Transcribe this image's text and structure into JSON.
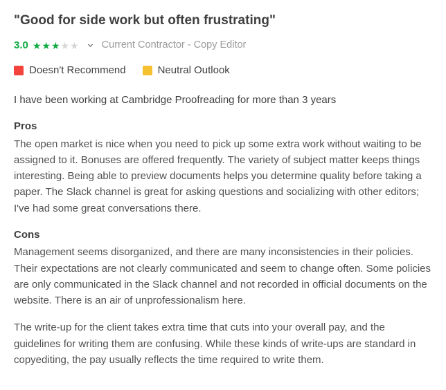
{
  "review": {
    "title": "\"Good for side work but often frustrating\"",
    "rating": "3.0",
    "stars_full": 3,
    "stars_total": 5,
    "author": "Current Contractor - Copy Editor",
    "indicators": [
      {
        "color": "red",
        "label": "Doesn't Recommend"
      },
      {
        "color": "yellow",
        "label": "Neutral Outlook"
      }
    ],
    "tenure": "I have been working at Cambridge Proofreading for more than 3 years",
    "pros_heading": "Pros",
    "pros_body": "The open market is nice when you need to pick up some extra work without waiting to be assigned to it. Bonuses are offered frequently. The variety of subject matter keeps things interesting. Being able to preview documents helps you determine quality before taking a paper. The Slack channel is great for asking questions and socializing with other editors; I've had some great conversations there.",
    "cons_heading": "Cons",
    "cons_body_1": "Management seems disorganized, and there are many inconsistencies in their policies. Their expectations are not clearly communicated and seem to change often. Some policies are only communicated in the Slack channel and not recorded in official documents on the website. There is an air of unprofessionalism here.",
    "cons_body_2": "The write-up for the client takes extra time that cuts into your overall pay, and the guidelines for writing them are confusing. While these kinds of write-ups are standard in copyediting, the pay usually reflects the time required to write them."
  }
}
